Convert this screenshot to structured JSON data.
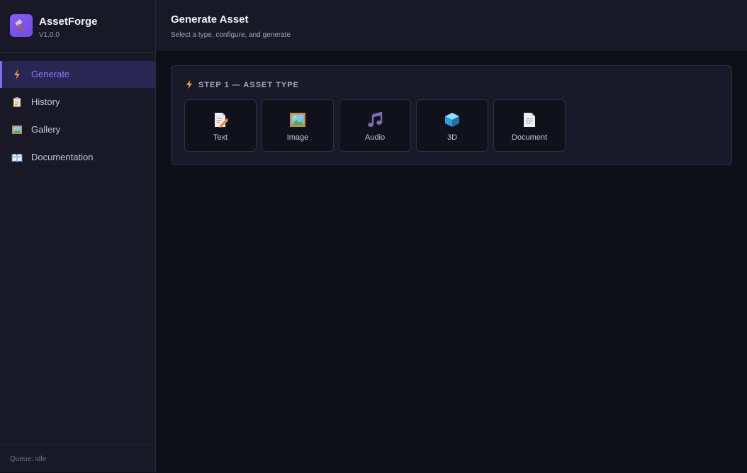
{
  "app": {
    "name": "AssetForge",
    "version": "V1.0.0",
    "logo_icon": "hammer-icon",
    "brand_color": "#8b5cf6"
  },
  "sidebar": {
    "items": [
      {
        "label": "Generate",
        "icon": "lightning-icon",
        "active": true
      },
      {
        "label": "History",
        "icon": "clipboard-icon",
        "active": false
      },
      {
        "label": "Gallery",
        "icon": "picture-icon",
        "active": false
      },
      {
        "label": "Documentation",
        "icon": "book-icon",
        "active": false
      }
    ],
    "queue_status": "Queue: idle"
  },
  "header": {
    "title": "Generate Asset",
    "subtitle": "Select a type, configure, and generate"
  },
  "step1": {
    "title": "STEP 1 — ASSET TYPE",
    "icon": "lightning-icon",
    "types": [
      {
        "label": "Text",
        "icon": "memo-icon"
      },
      {
        "label": "Image",
        "icon": "framed-picture-icon"
      },
      {
        "label": "Audio",
        "icon": "music-note-icon"
      },
      {
        "label": "3D",
        "icon": "cube-icon"
      },
      {
        "label": "Document",
        "icon": "document-icon"
      }
    ]
  }
}
